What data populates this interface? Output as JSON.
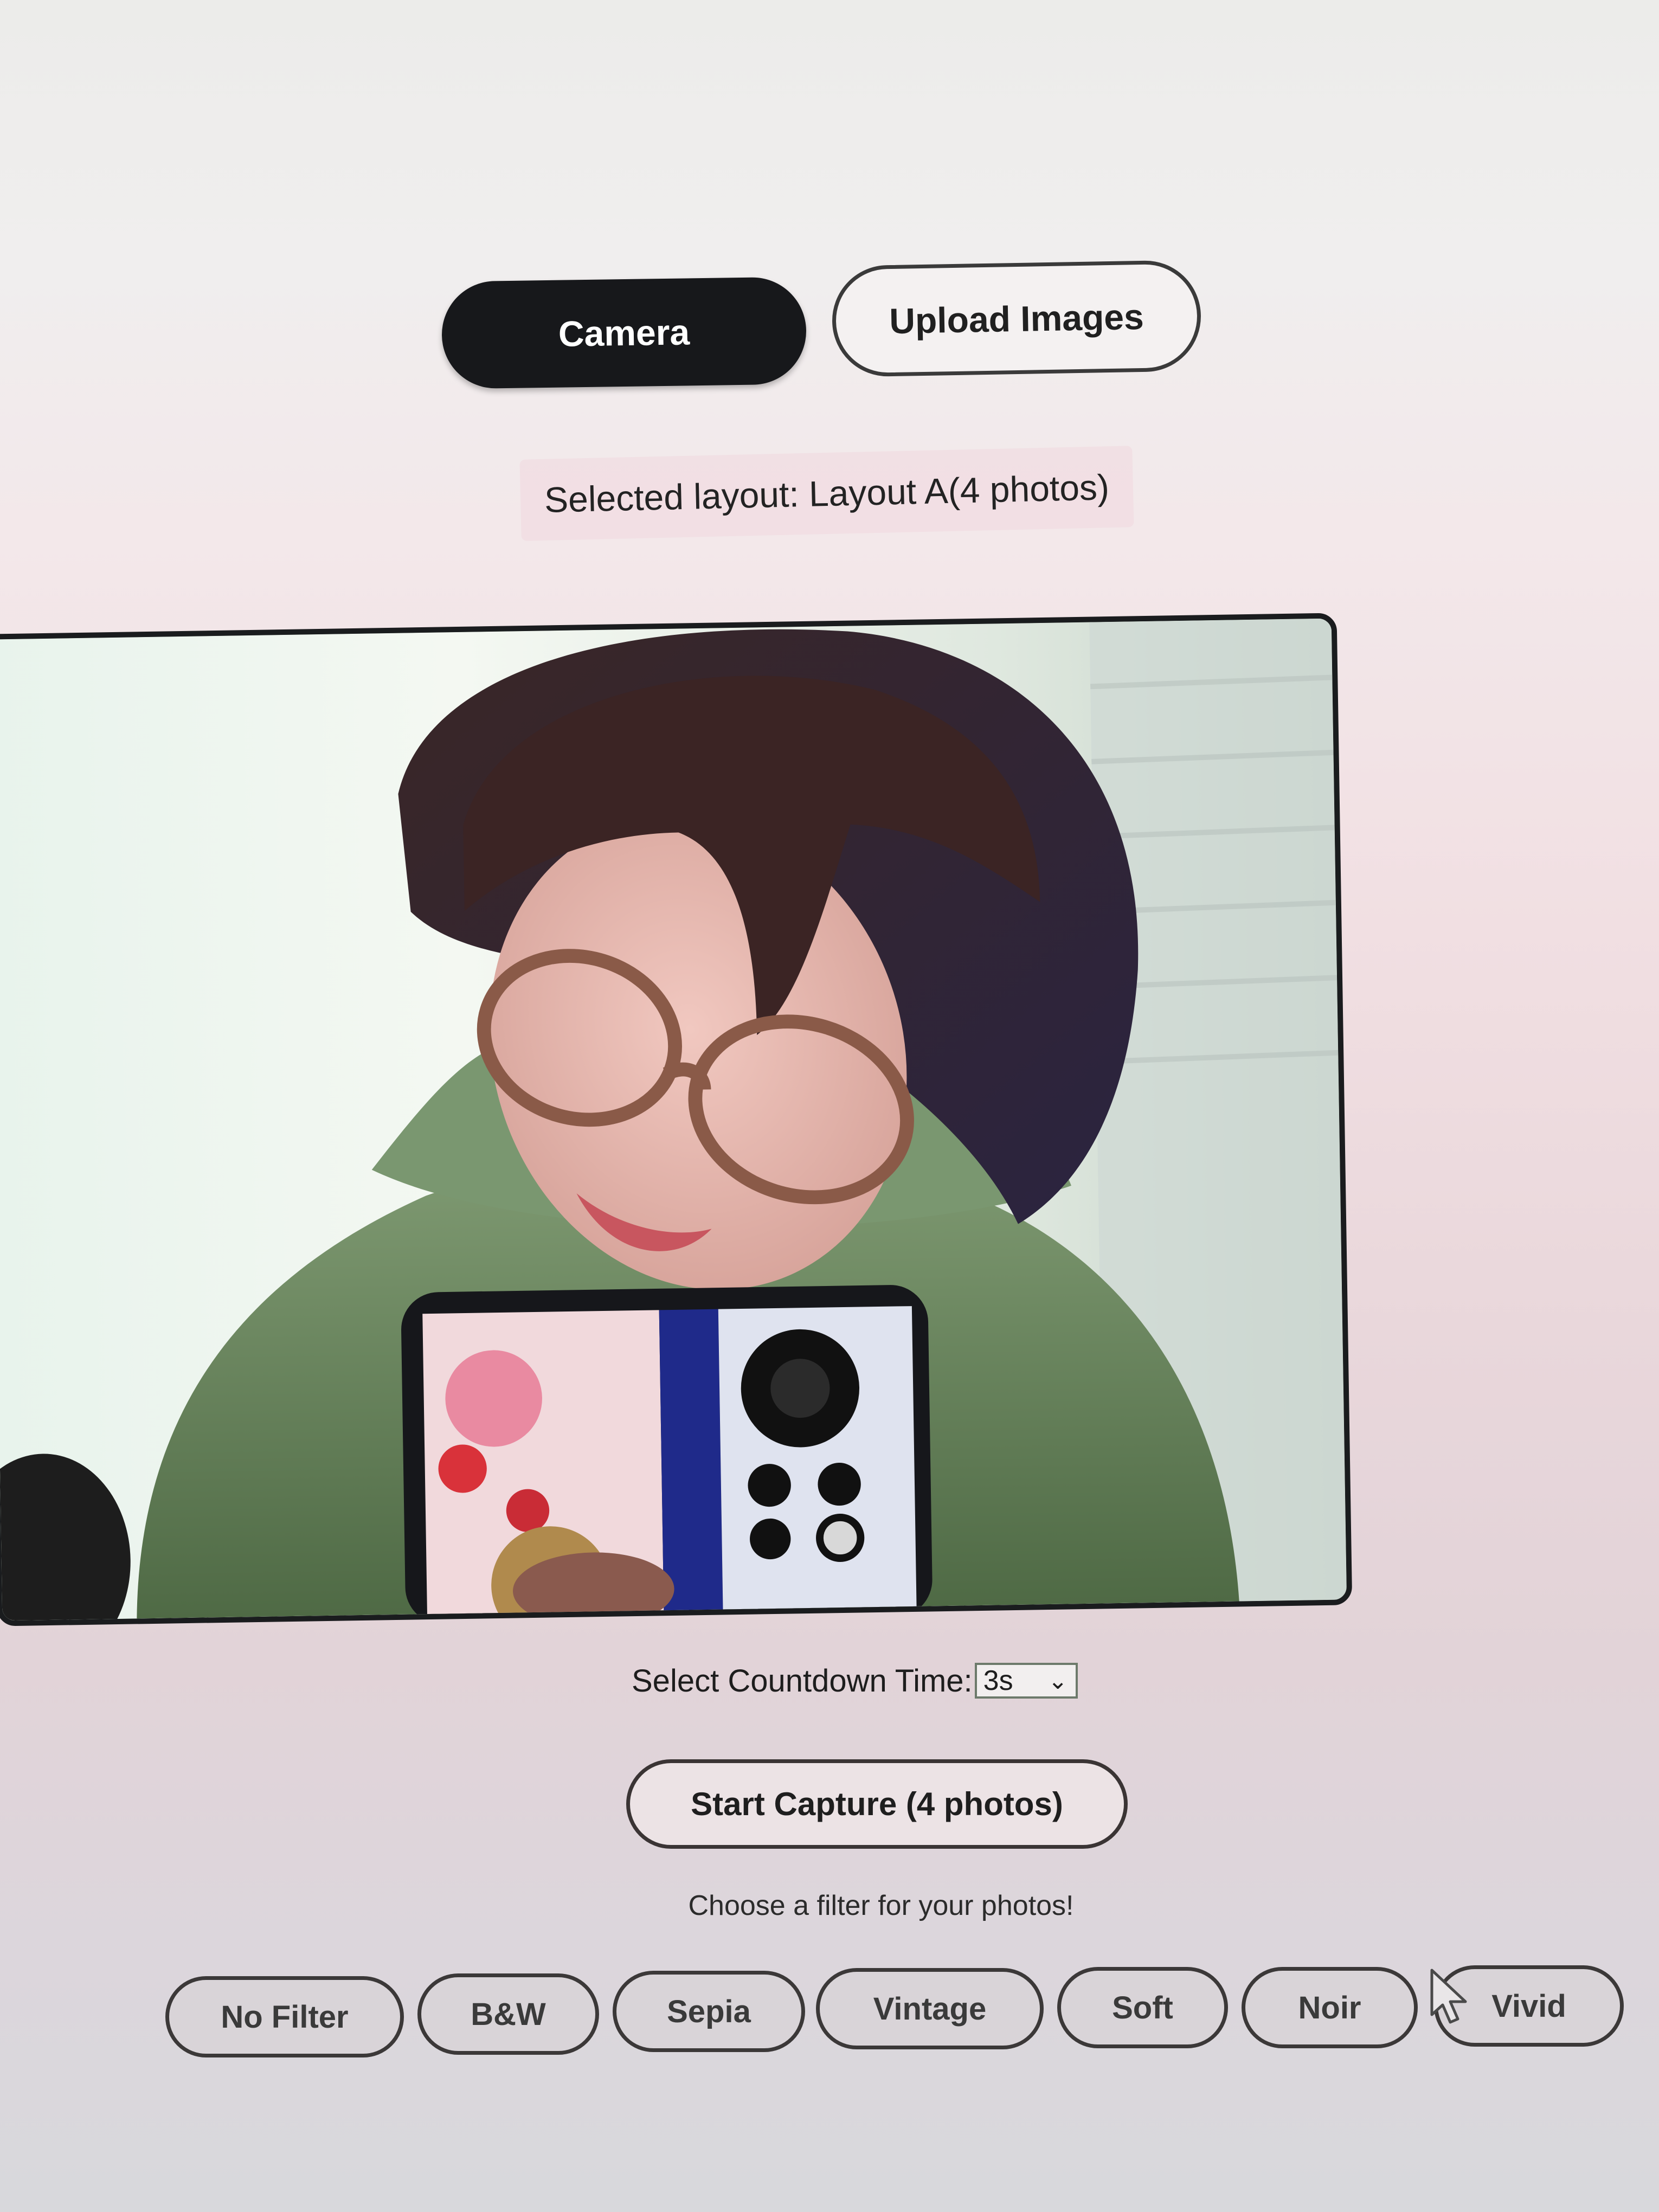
{
  "mode_toggle": {
    "camera_label": "Camera",
    "upload_label": "Upload Images",
    "active": "Camera"
  },
  "layout": {
    "label": "Selected layout: Layout A(4 photos)"
  },
  "countdown": {
    "label": "Select Countdown Time:",
    "selected": "3s"
  },
  "capture": {
    "label": "Start Capture (4 photos)"
  },
  "filters": {
    "hint": "Choose a filter for your photos!",
    "items": [
      "No Filter",
      "B&W",
      "Sepia",
      "Vintage",
      "Soft",
      "Noir",
      "Vivid"
    ]
  },
  "colors": {
    "active_button": "#17181b",
    "outline": "#3a3a3a"
  },
  "icons": {
    "select_chevron": "chevron-down-icon",
    "cursor": "mouse-cursor-icon"
  }
}
